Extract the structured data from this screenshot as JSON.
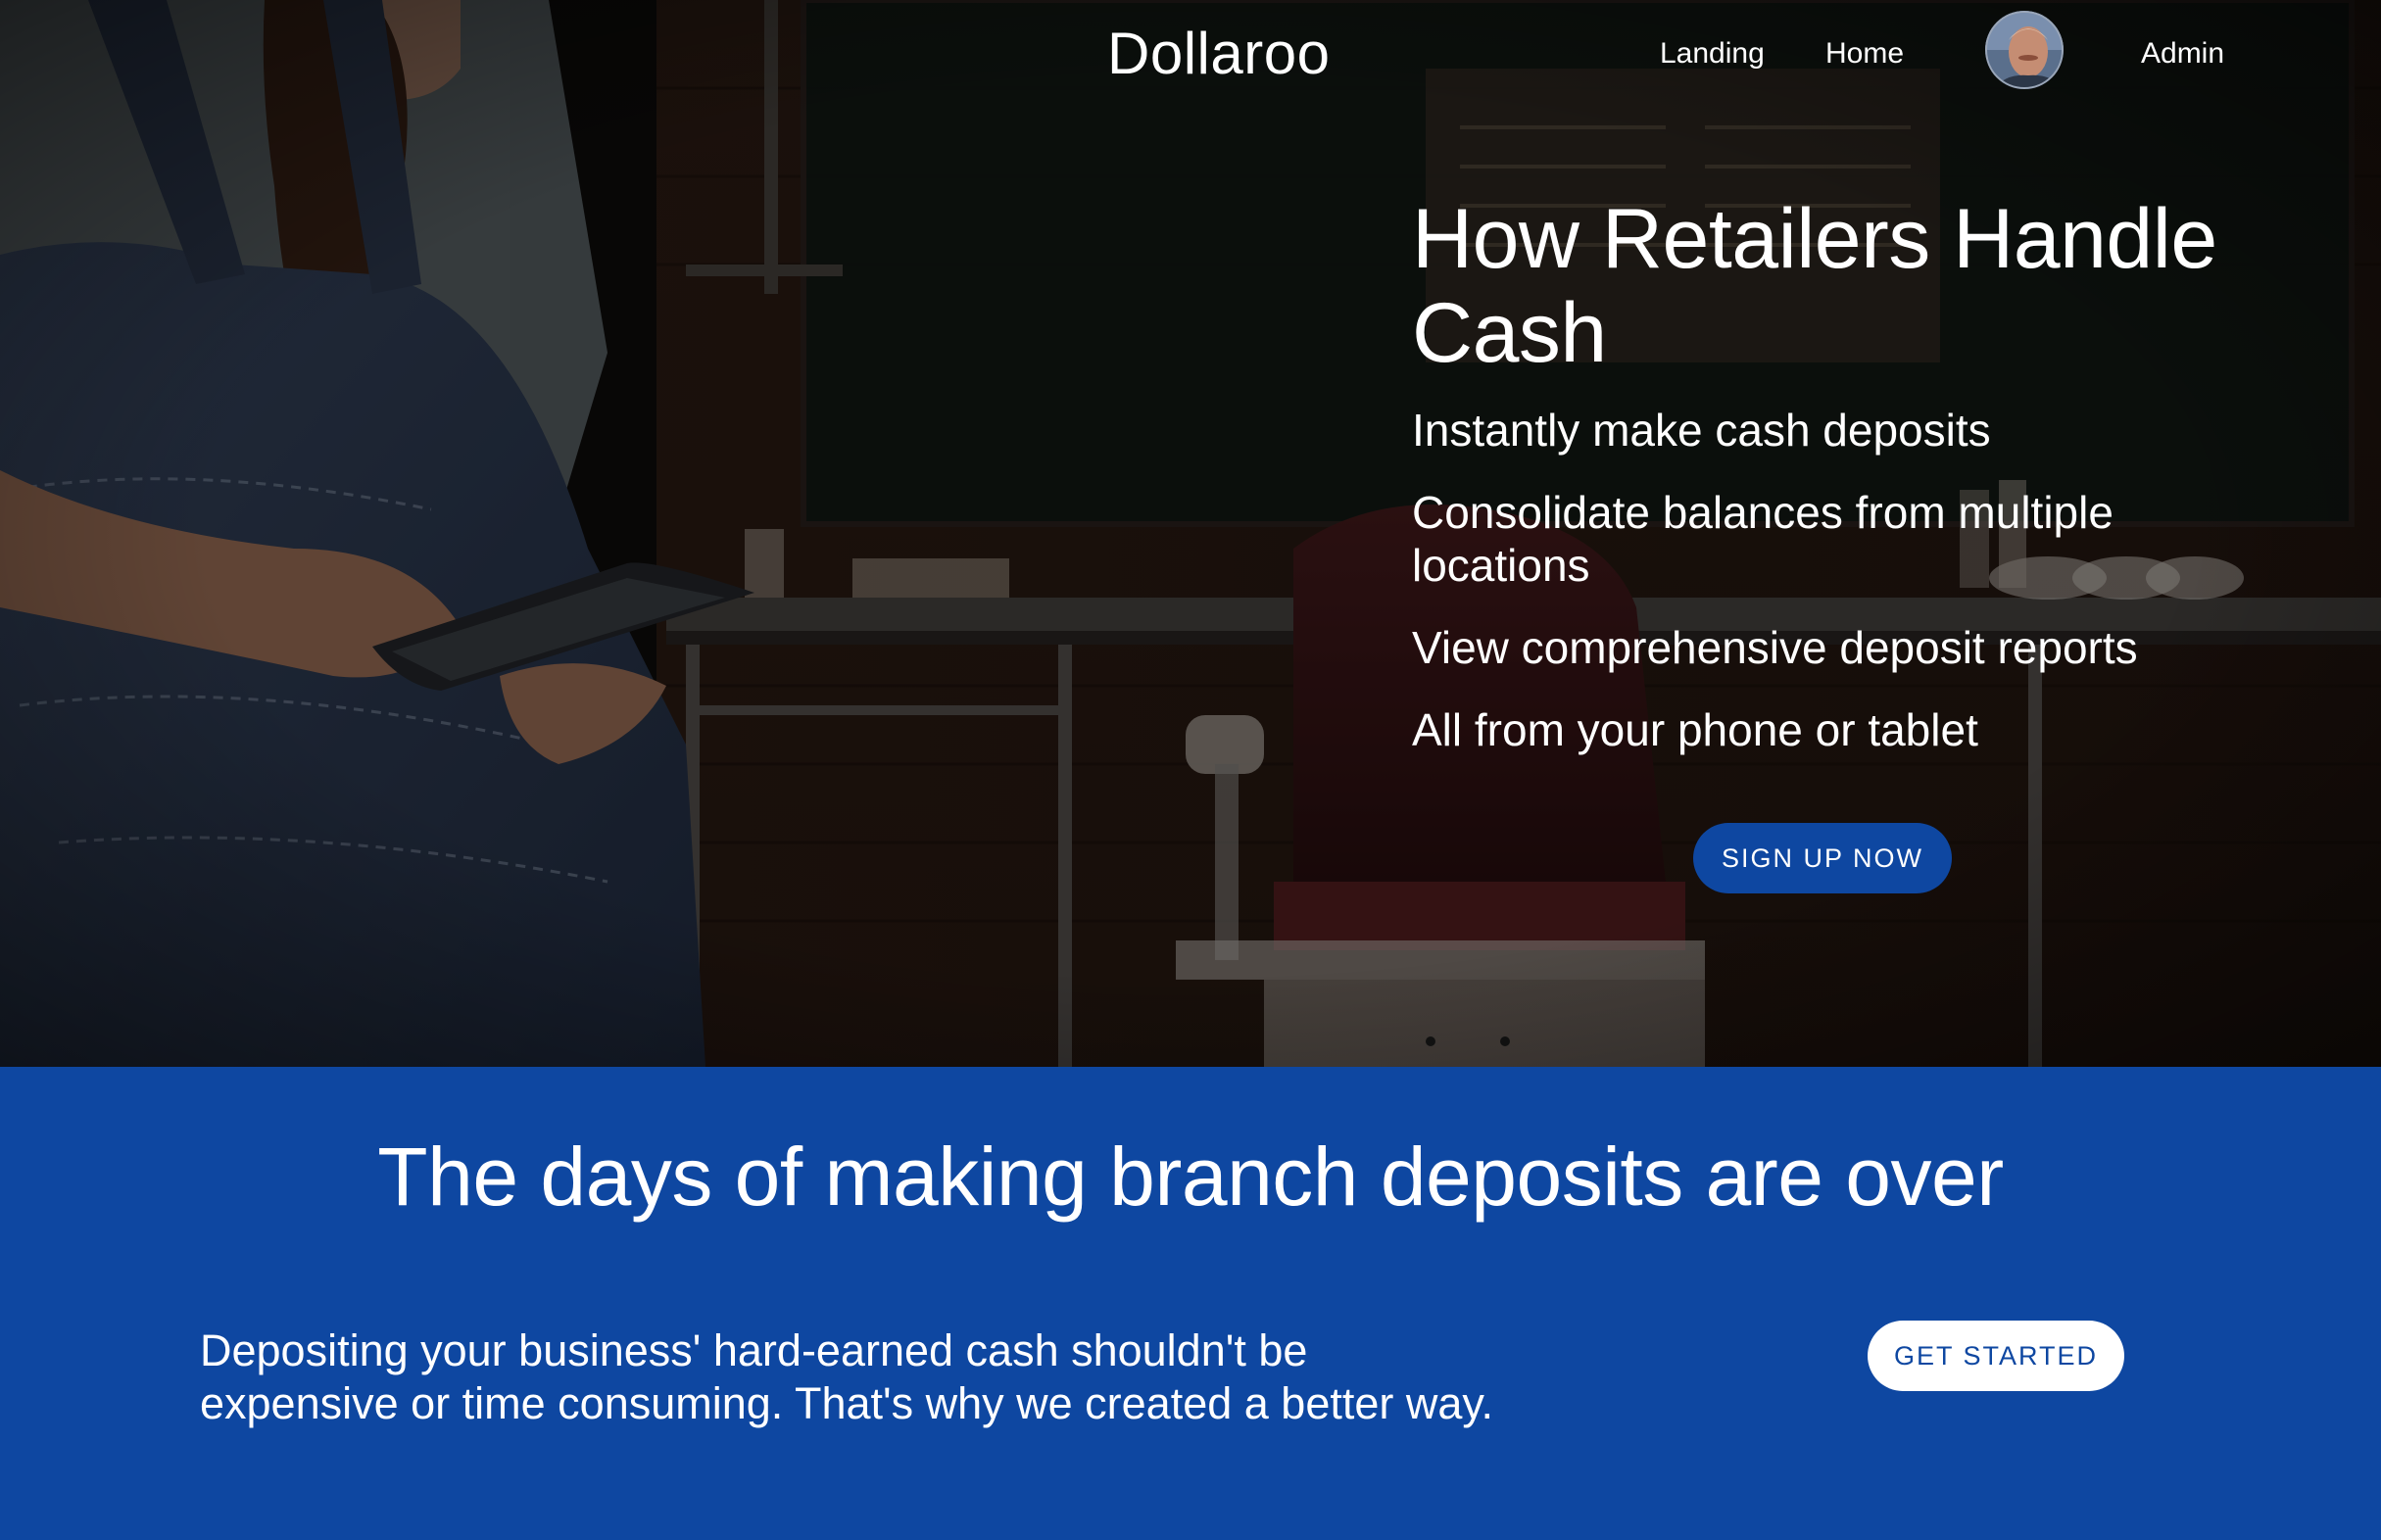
{
  "header": {
    "brand": "Dollaroo",
    "nav": [
      {
        "label": "Landing"
      },
      {
        "label": "Home"
      },
      {
        "label": "Admin"
      }
    ]
  },
  "hero": {
    "title": "How Retailers Handle Cash",
    "features": [
      "Instantly make cash deposits",
      "Consolidate balances from multiple locations",
      "View comprehensive deposit reports",
      "All from your phone or tablet"
    ],
    "cta_label": "Sign up now"
  },
  "info": {
    "title": "The days of making branch deposits are over",
    "body": "Depositing your business' hard-earned cash shouldn't be expensive or time consuming. That's why we created a better way.",
    "cta_label": "Get started"
  },
  "colors": {
    "primary": "#0e47a1",
    "hero_overlay": "#140f0c",
    "text_on_dark": "#ffffff"
  }
}
